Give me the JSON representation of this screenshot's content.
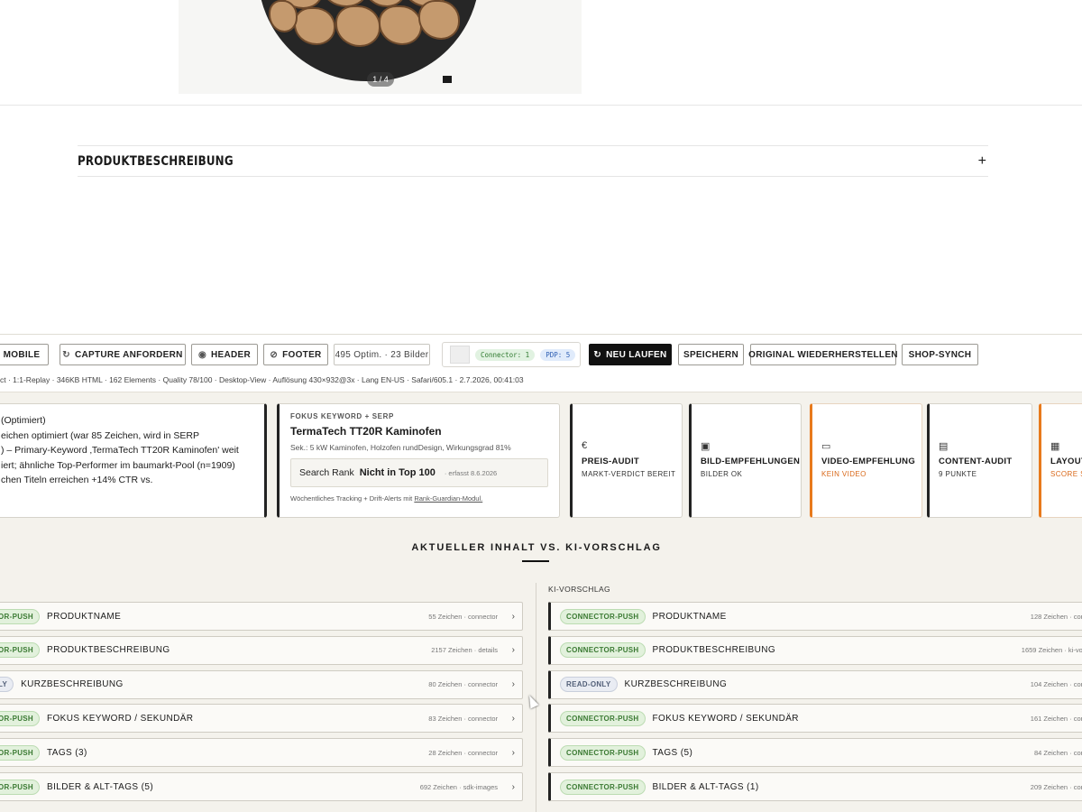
{
  "product": {
    "image_counter": "1 / 4",
    "description_title": "PRODUKTBESCHREIBUNG",
    "description_toggle": "+"
  },
  "toolbar": {
    "mobile_label": "MOBILE",
    "capture_label": "CAPTURE ANFORDERN",
    "header_label": "HEADER",
    "footer_label": "FOOTER",
    "optim_label": "495 Optim. · 23 Bilder",
    "connector_pill": "Connector: 1",
    "pdp_pill": "PDP: 5",
    "rerun_label": "NEU LAUFEN",
    "save_label": "SPEICHERN",
    "restore_label": "ORIGINAL WIEDERHERSTELLEN",
    "sync_label": "SHOP-SYNCH",
    "status_line": "ct · 1:1-Replay · 346KB HTML · 162 Elements · Quality 78/100 · Desktop-View · Auflösung 430×932@3x · Lang EN-US · Safari/605.1 · 2.7.2026, 00:41:03"
  },
  "title_card": {
    "lines": [
      "(Optimiert)",
      "eichen optimiert (war 85 Zeichen, wird in SERP",
      ") – Primary-Keyword ‚TermaTech TT20R Kaminofen' weit",
      "iert; ähnliche Top-Performer im baumarkt-Pool (n=1909)",
      "chen Titeln erreichen +14% CTR vs."
    ]
  },
  "focus_card": {
    "kicker": "FOKUS KEYWORD + SERP",
    "title": "TermaTech TT20R Kaminofen",
    "subtitle": "Sek.: 5 kW Kaminofen, Holzofen rundDesign, Wirkungsgrad 81%",
    "rank_label": "Search Rank",
    "rank_value": "Nicht in Top 100",
    "rank_date": "· erfasst 8.6.2026",
    "footer_text": "Wöchentliches Tracking + Drift-Alerts mit",
    "footer_link": "Rank-Guardian-Modul."
  },
  "audits": [
    {
      "icon": "€",
      "title": "PREIS-AUDIT",
      "sub": "MARKT-VERDICT BEREIT"
    },
    {
      "icon": "▣",
      "title": "BILD-EMPFEHLUNGEN",
      "sub": "BILDER OK"
    },
    {
      "icon": "▭",
      "title": "VIDEO-EMPFEHLUNG",
      "sub": "KEIN VIDEO"
    },
    {
      "icon": "▤",
      "title": "CONTENT-AUDIT",
      "sub": "9 PUNKTE"
    },
    {
      "icon": "▦",
      "title": "LAYOUT",
      "sub": "SCORE S"
    }
  ],
  "comparison": {
    "heading": "AKTUELLER INHALT VS. KI-VORSCHLAG",
    "right_label": "KI-VORSCHLAG",
    "left_rows": [
      {
        "tag": "OR-PUSH",
        "label": "PRODUKTNAME",
        "meta": "55 Zeichen · connector"
      },
      {
        "tag": "OR-PUSH",
        "label": "PRODUKTBESCHREIBUNG",
        "meta": "2157 Zeichen · details"
      },
      {
        "tag": "LY",
        "label": "KURZBESCHREIBUNG",
        "meta": "80 Zeichen · connector"
      },
      {
        "tag": "OR-PUSH",
        "label": "FOKUS KEYWORD / SEKUNDÄR",
        "meta": "83 Zeichen · connector"
      },
      {
        "tag": "OR-PUSH",
        "label": "TAGS (3)",
        "meta": "28 Zeichen · connector"
      },
      {
        "tag": "OR-PUSH",
        "label": "BILDER & ALT-TAGS (5)",
        "meta": "692 Zeichen · sdk-images"
      }
    ],
    "right_rows": [
      {
        "tag": "CONNECTOR-PUSH",
        "label": "PRODUKTNAME",
        "meta": "128 Zeichen · conn"
      },
      {
        "tag": "CONNECTOR-PUSH",
        "label": "PRODUKTBESCHREIBUNG",
        "meta": "1659 Zeichen · ki-vors"
      },
      {
        "tag": "READ-ONLY",
        "label": "KURZBESCHREIBUNG",
        "meta": "104 Zeichen · conn"
      },
      {
        "tag": "CONNECTOR-PUSH",
        "label": "FOKUS KEYWORD / SEKUNDÄR",
        "meta": "161 Zeichen · conn"
      },
      {
        "tag": "CONNECTOR-PUSH",
        "label": "TAGS (5)",
        "meta": "84 Zeichen · conn"
      },
      {
        "tag": "CONNECTOR-PUSH",
        "label": "BILDER & ALT-TAGS (1)",
        "meta": "209 Zeichen · conn"
      }
    ]
  }
}
